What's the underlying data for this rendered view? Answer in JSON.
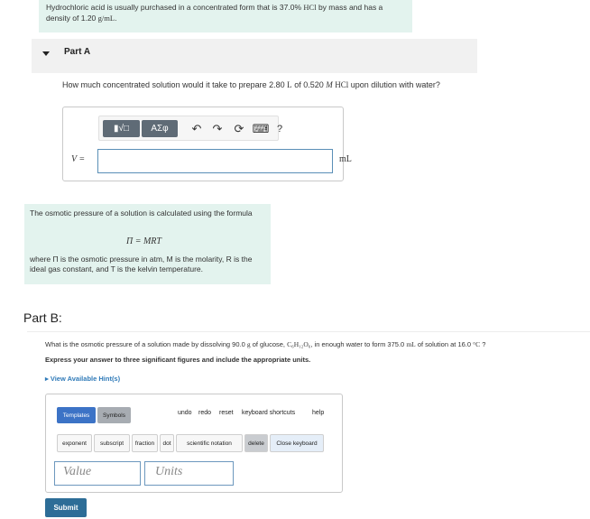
{
  "intro": {
    "text_1": "Hydrochloric acid is usually purchased in a concentrated form that is 37.0",
    "percent": "%",
    "chem": "HCl",
    "text_2": "by mass and has a density of 1.20",
    "density_unit": "g/mL",
    "end": "."
  },
  "partA": {
    "title": "Part A",
    "q_1": "How much concentrated solution would it take to prepare 2.80",
    "q_unit1": "L",
    "q_2": "of 0.520",
    "q_M": "M",
    "q_chem": "HCl",
    "q_3": "upon dilution with water?",
    "toolbar": {
      "templates_glyph": "▮√□",
      "symbols_glyph": "ΑΣφ",
      "undo_glyph": "↶",
      "redo_glyph": "↷",
      "reset_glyph": "⟳",
      "keyboard_glyph": "⌨",
      "help_glyph": "?"
    },
    "var_label": "V =",
    "unit": "mL"
  },
  "info": {
    "line1": "The osmotic pressure of a solution is calculated using the formula",
    "formula": "Π = MRT",
    "where": "where Π is the osmotic pressure in atm, M is the molarity, R is the ideal gas constant, and T is the kelvin temperature."
  },
  "partB": {
    "title": "Part B:",
    "q_1": "What is the osmotic pressure of a solution made by dissolving 90.0",
    "q_g": "g",
    "q_2": "of glucose,",
    "q_formula": "C₆H₁₂O₆",
    "q_3": ", in enough water to form 375.0",
    "q_mL": "mL",
    "q_4": "of solution at 16.0",
    "q_degC": "°C",
    "q_5": "?",
    "instructions": "Express your answer to three significant figures and include the appropriate units.",
    "hint_link": "View Available Hint(s)",
    "toolbar": {
      "templates": "Templates",
      "symbols": "Symbols",
      "undo": "undo",
      "redo": "redo",
      "reset": "reset",
      "keyboard_shortcuts": "keyboard shortcuts",
      "help": "help",
      "exponent": "exponent",
      "subscript": "subscript",
      "fraction": "fraction",
      "dot": "dot",
      "scientific_notation": "scientific notation",
      "delete": "delete",
      "close_keyboard": "Close keyboard"
    },
    "value_placeholder": "Value",
    "units_placeholder": "Units"
  },
  "submit_label": "Submit",
  "colors": {
    "info_bg": "#e3f3ee",
    "accent_blue": "#3c73c6",
    "submit_bg": "#2d6d97",
    "link_blue": "#2f7ab8"
  }
}
